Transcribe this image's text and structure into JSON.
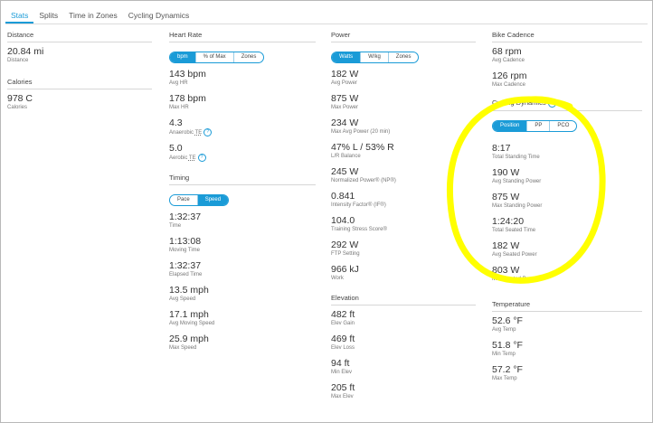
{
  "tabs": [
    "Stats",
    "Splits",
    "Time in Zones",
    "Cycling Dynamics"
  ],
  "col1": {
    "distance": {
      "title": "Distance",
      "value": "20.84 mi",
      "label": "Distance"
    },
    "calories": {
      "title": "Calories",
      "value": "978 C",
      "label": "Calories"
    }
  },
  "heart_rate": {
    "title": "Heart Rate",
    "toggle": [
      "bpm",
      "% of Max",
      "Zones"
    ],
    "stats": [
      {
        "value": "143 bpm",
        "label": "Avg HR"
      },
      {
        "value": "178 bpm",
        "label": "Max HR"
      },
      {
        "value": "4.3",
        "label_prefix": "Anaerobic ",
        "label_te": "TE"
      },
      {
        "value": "5.0",
        "label_prefix": "Aerobic ",
        "label_te": "TE"
      }
    ]
  },
  "timing": {
    "title": "Timing",
    "toggle": [
      "Pace",
      "Speed"
    ],
    "stats": [
      {
        "value": "1:32:37",
        "label": "Time"
      },
      {
        "value": "1:13:08",
        "label": "Moving Time"
      },
      {
        "value": "1:32:37",
        "label": "Elapsed Time"
      },
      {
        "value": "13.5 mph",
        "label": "Avg Speed"
      },
      {
        "value": "17.1 mph",
        "label": "Avg Moving Speed"
      },
      {
        "value": "25.9 mph",
        "label": "Max Speed"
      }
    ]
  },
  "power": {
    "title": "Power",
    "toggle": [
      "Watts",
      "W/kg",
      "Zones"
    ],
    "stats": [
      {
        "value": "182 W",
        "label": "Avg Power"
      },
      {
        "value": "875 W",
        "label": "Max Power"
      },
      {
        "value": "234 W",
        "label": "Max Avg Power (20 min)"
      },
      {
        "value": "47% L / 53% R",
        "label": "L/R Balance"
      },
      {
        "value": "245 W",
        "label": "Normalized Power® (NP®)"
      },
      {
        "value": "0.841",
        "label": "Intensity Factor® (IF®)"
      },
      {
        "value": "104.0",
        "label": "Training Stress Score®"
      },
      {
        "value": "292 W",
        "label": "FTP Setting"
      },
      {
        "value": "966 kJ",
        "label": "Work"
      }
    ]
  },
  "elevation": {
    "title": "Elevation",
    "stats": [
      {
        "value": "482 ft",
        "label": "Elev Gain"
      },
      {
        "value": "469 ft",
        "label": "Elev Loss"
      },
      {
        "value": "94 ft",
        "label": "Min Elev"
      },
      {
        "value": "205 ft",
        "label": "Max Elev"
      }
    ]
  },
  "cadence": {
    "title": "Bike Cadence",
    "stats": [
      {
        "value": "68 rpm",
        "label": "Avg Cadence"
      },
      {
        "value": "126 rpm",
        "label": "Max Cadence"
      }
    ]
  },
  "cycling_dynamics": {
    "title": "Cycling Dynamics",
    "toggle": [
      "Position",
      "PP",
      "PCO"
    ],
    "stats": [
      {
        "value": "8:17",
        "label": "Total Standing Time"
      },
      {
        "value": "190 W",
        "label": "Avg Standing Power"
      },
      {
        "value": "875 W",
        "label": "Max Standing Power"
      },
      {
        "value": "1:24:20",
        "label": "Total Seated Time"
      },
      {
        "value": "182 W",
        "label": "Avg Seated Power"
      },
      {
        "value": "803 W",
        "label": "Max Seated Power"
      }
    ]
  },
  "temperature": {
    "title": "Temperature",
    "stats": [
      {
        "value": "52.6 °F",
        "label": "Avg Temp"
      },
      {
        "value": "51.8 °F",
        "label": "Min Temp"
      },
      {
        "value": "57.2 °F",
        "label": "Max Temp"
      }
    ]
  },
  "colors": {
    "accent": "#1a9bd7",
    "highlight": "#ffff00"
  }
}
